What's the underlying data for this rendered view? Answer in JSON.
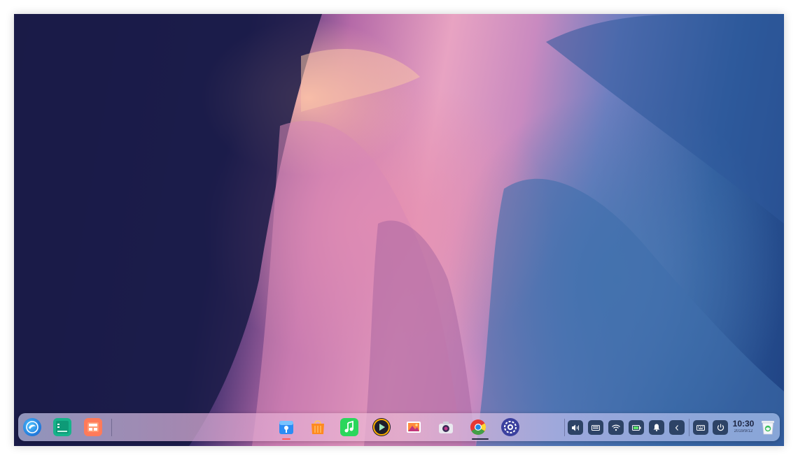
{
  "desktop": {
    "wallpaper_colors": [
      "#1b1d4d",
      "#e8a3c2",
      "#2f5d9d"
    ]
  },
  "dock": {
    "left_apps": [
      {
        "name": "launcher",
        "icon": "deepin-launcher-icon"
      },
      {
        "name": "multitasking",
        "icon": "multitask-view-icon"
      },
      {
        "name": "show-desktop",
        "icon": "show-desktop-icon"
      }
    ],
    "center_apps": [
      {
        "name": "file-manager",
        "icon": "folder-icon",
        "running": true
      },
      {
        "name": "app-store",
        "icon": "shopping-bag-icon",
        "running": false
      },
      {
        "name": "music",
        "icon": "music-note-icon",
        "running": false
      },
      {
        "name": "movie",
        "icon": "play-icon",
        "running": false
      },
      {
        "name": "image-viewer",
        "icon": "picture-icon",
        "running": false
      },
      {
        "name": "camera",
        "icon": "camera-icon",
        "running": false
      },
      {
        "name": "chrome",
        "icon": "chrome-icon",
        "running": true
      },
      {
        "name": "control-center",
        "icon": "gear-icon",
        "running": false
      }
    ],
    "tray": [
      {
        "name": "volume",
        "icon": "volume-icon"
      },
      {
        "name": "keyboard",
        "icon": "keyboard-icon"
      },
      {
        "name": "wifi",
        "icon": "wifi-icon"
      },
      {
        "name": "battery",
        "icon": "battery-icon"
      },
      {
        "name": "notifications",
        "icon": "bell-icon"
      },
      {
        "name": "expand",
        "icon": "chevron-left-icon"
      },
      {
        "name": "onboard-keyboard",
        "icon": "onscreen-keyboard-icon"
      },
      {
        "name": "shutdown",
        "icon": "power-icon"
      }
    ],
    "clock": {
      "time": "10:30",
      "date": "2019/9/12"
    },
    "trash": {
      "icon": "trash-icon"
    },
    "accent_color": "#ff5a5a"
  }
}
